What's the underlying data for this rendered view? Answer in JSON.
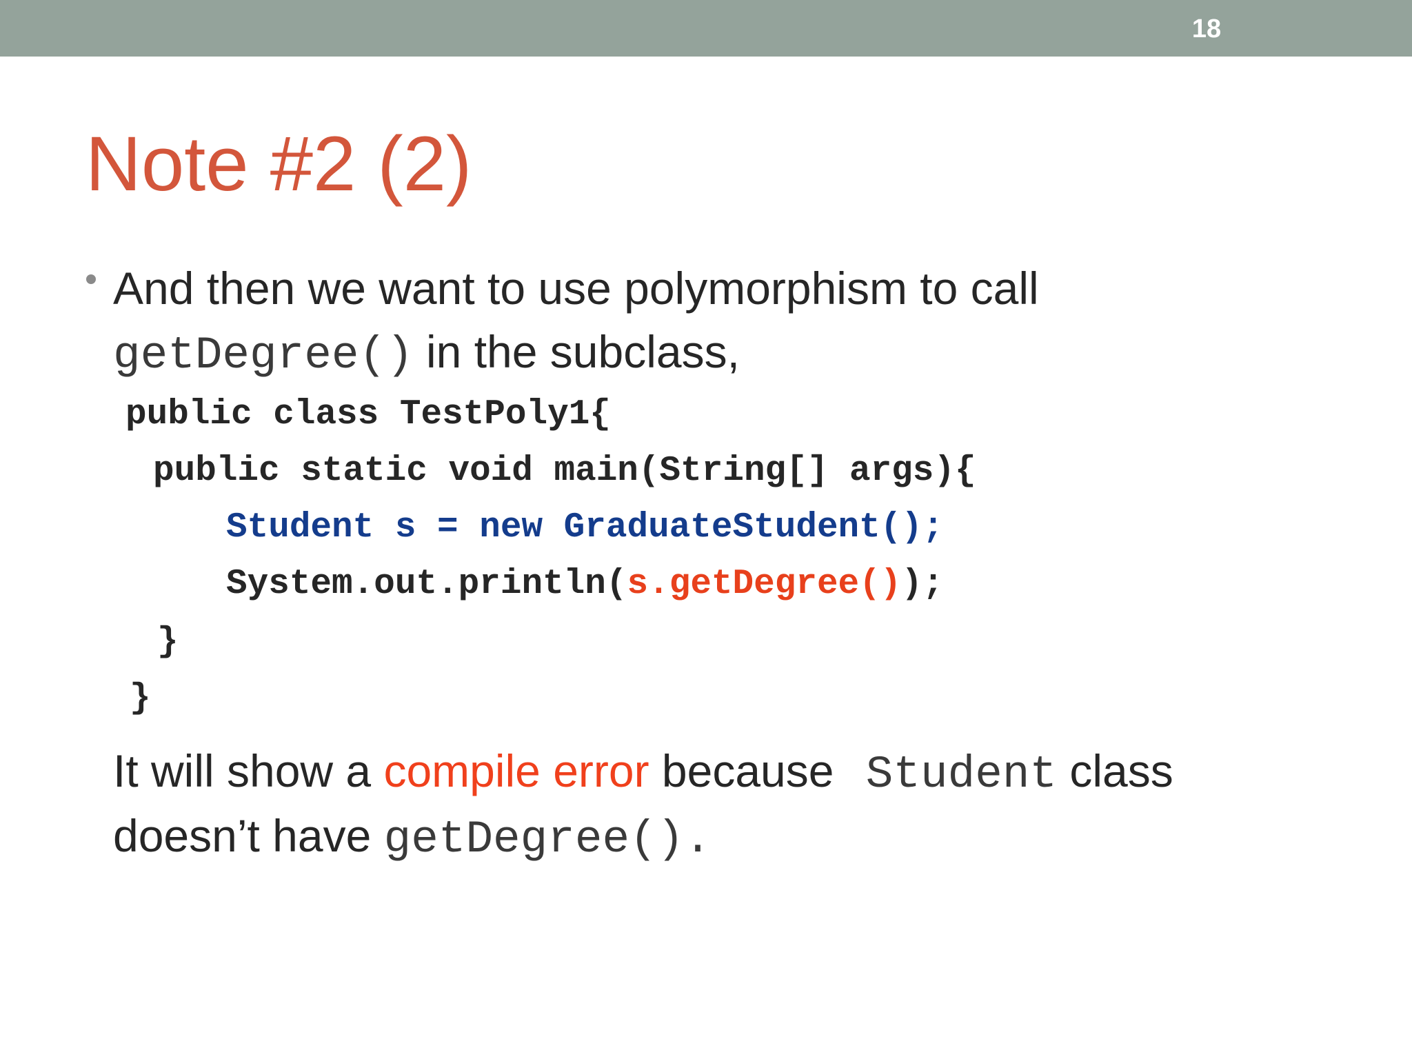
{
  "header": {
    "slide_number": "18",
    "bar_color": "#94a39b"
  },
  "slide": {
    "title": "Note #2 (2)",
    "title_color": "#d3563b",
    "bullet": {
      "line1": "And then we want to use polymorphism to call",
      "line2_code": "getDegree()",
      "line2_text": " in the subclass,"
    },
    "code": {
      "line1": "public class TestPoly1{",
      "line2": "public static void main(String[] args){",
      "line3": "Student s = new GraduateStudent();",
      "line4_prefix": "System.out.println(",
      "line4_highlight": "s.getDegree()",
      "line4_suffix": ");",
      "line5": "}",
      "line6": "}",
      "blue_color": "#143c8c",
      "red_color": "#e8401c"
    },
    "conclusion": {
      "part1": "It will show a ",
      "highlight": "compile error",
      "part2": " because ",
      "code1": "Student",
      "part3": " class",
      "part4": "doesn’t have ",
      "code2": "getDegree()."
    }
  }
}
